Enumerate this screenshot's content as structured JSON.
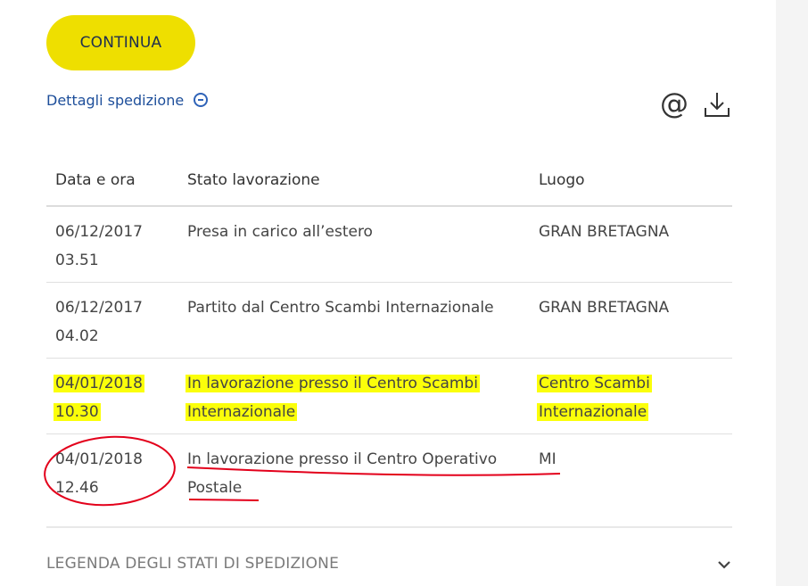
{
  "actions": {
    "continue_label": "CONTINUA",
    "details_label": "Dettagli spedizione"
  },
  "icons": {
    "email": "at-icon",
    "download": "download-icon",
    "collapse": "minus-circle-icon",
    "expand": "chevron-down-icon"
  },
  "table": {
    "headers": [
      "Data e ora",
      "Stato lavorazione",
      "Luogo"
    ],
    "rows": [
      {
        "date": "06/12/2017",
        "time": "03.51",
        "status_line1": "Presa in carico all’estero",
        "status_line2": "",
        "place_line1": "GRAN BRETAGNA",
        "place_line2": ""
      },
      {
        "date": "06/12/2017",
        "time": "04.02",
        "status_line1": "Partito dal Centro Scambi Internazionale",
        "status_line2": "",
        "place_line1": "GRAN BRETAGNA",
        "place_line2": ""
      },
      {
        "date": "04/01/2018",
        "time": "10.30",
        "status_line1": "In lavorazione presso il Centro Scambi",
        "status_line2": "Internazionale",
        "place_line1": "Centro Scambi",
        "place_line2": "Internazionale"
      },
      {
        "date": "04/01/2018",
        "time": "12.46",
        "status_line1": "In lavorazione presso il Centro Operativo",
        "status_line2": "Postale",
        "place_line1": "MI",
        "place_line2": ""
      }
    ]
  },
  "legend": {
    "label": "LEGENDA DEGLI STATI DI SPEDIZIONE"
  },
  "colors": {
    "button_yellow": "#eedf00",
    "link_blue": "#1d4e9a",
    "highlight": "#fbff0a",
    "annotation_red": "#e3001b"
  }
}
